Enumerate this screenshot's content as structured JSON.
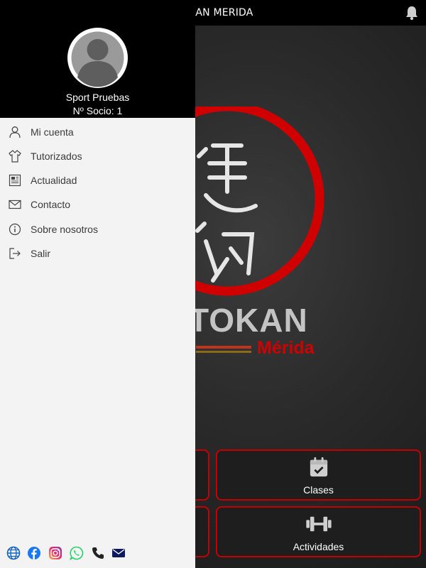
{
  "appbar": {
    "title": "OKAN MERIDA",
    "notifications_icon": "bell-icon"
  },
  "logo": {
    "wordmark": "TOKAN",
    "city": "Mérida"
  },
  "tiles": [
    {
      "label": "Clases",
      "icon": "calendar-check-icon"
    },
    {
      "label": "Actividades",
      "icon": "dumbbell-icon"
    }
  ],
  "drawer": {
    "user": {
      "name": "Sport Pruebas",
      "member_number": "Nº Socio: 1",
      "avatar_icon": "user-avatar-icon"
    },
    "menu": [
      {
        "label": "Mi cuenta",
        "icon": "user-icon"
      },
      {
        "label": "Tutorizados",
        "icon": "shirt-icon"
      },
      {
        "label": "Actualidad",
        "icon": "newspaper-icon"
      },
      {
        "label": "Contacto",
        "icon": "envelope-icon"
      },
      {
        "label": "Sobre nosotros",
        "icon": "info-icon"
      },
      {
        "label": "Salir",
        "icon": "logout-icon"
      }
    ],
    "social": [
      "globe-icon",
      "facebook-icon",
      "instagram-icon",
      "whatsapp-icon",
      "phone-icon",
      "mail-icon"
    ]
  },
  "colors": {
    "accent_red": "#c40000",
    "drawer_bg": "#f3f3f3",
    "header_bg": "#000000"
  }
}
